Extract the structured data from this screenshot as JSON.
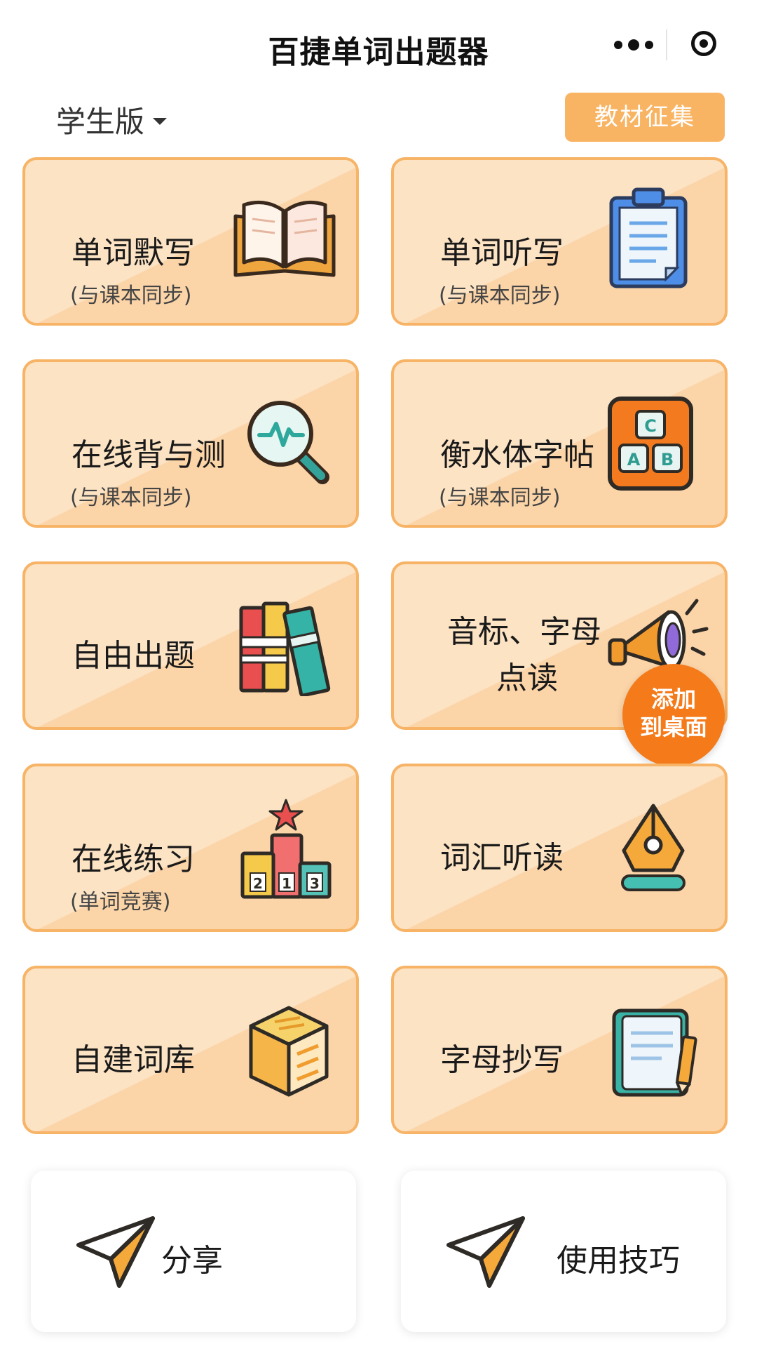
{
  "nav": {
    "title": "百捷单词出题器"
  },
  "toolbar": {
    "edition": "学生版",
    "collect_button": "教材征集"
  },
  "cards": [
    {
      "title": "单词默写",
      "subtitle": "(与课本同步)",
      "icon": "open-book-icon"
    },
    {
      "title": "单词听写",
      "subtitle": "(与课本同步)",
      "icon": "clipboard-icon"
    },
    {
      "title": "在线背与测",
      "subtitle": "(与课本同步)",
      "icon": "magnifier-icon"
    },
    {
      "title": "衡水体字帖",
      "subtitle": "(与课本同步)",
      "icon": "abc-blocks-icon"
    },
    {
      "title": "自由出题",
      "subtitle": "",
      "icon": "books-icon"
    },
    {
      "title_line1": "音标、字母",
      "title_line2": "点读",
      "icon": "megaphone-icon"
    },
    {
      "title": "在线练习",
      "subtitle": "(单词竞赛)",
      "icon": "podium-icon",
      "podium": [
        "2",
        "1",
        "3"
      ]
    },
    {
      "title": "词汇听读",
      "subtitle": "",
      "icon": "pen-nib-icon"
    },
    {
      "title": "自建词库",
      "subtitle": "",
      "icon": "cube-icon"
    },
    {
      "title": "字母抄写",
      "subtitle": "",
      "icon": "notebook-pencil-icon"
    }
  ],
  "abc_letters": [
    "C",
    "A",
    "B"
  ],
  "badge": {
    "line1": "添加",
    "line2": "到桌面"
  },
  "bottom": {
    "share": "分享",
    "tips": "使用技巧"
  },
  "colors": {
    "accent": "#f8b463",
    "card_border": "#f7b366",
    "badge": "#f47a1a"
  }
}
